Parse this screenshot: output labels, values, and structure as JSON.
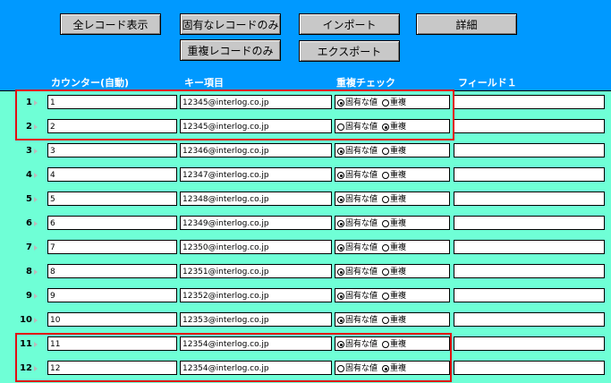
{
  "toolbar": {
    "all_records": "全レコード表示",
    "unique_records": "固有なレコードのみ",
    "duplicate_records": "重複レコードのみ",
    "import": "インポート",
    "export": "エクスポート",
    "details": "詳細"
  },
  "columns": {
    "counter": "カウンター(自動)",
    "key": "キー項目",
    "dup_check": "重複チェック",
    "field1": "フィールド１"
  },
  "radio_labels": {
    "unique": "固有な値",
    "duplicate": "重複"
  },
  "records": [
    {
      "num": "1",
      "counter": "1",
      "key": "12345@interlog.co.jp",
      "status": "unique",
      "field1": ""
    },
    {
      "num": "2",
      "counter": "2",
      "key": "12345@interlog.co.jp",
      "status": "duplicate",
      "field1": ""
    },
    {
      "num": "3",
      "counter": "3",
      "key": "12346@interlog.co.jp",
      "status": "unique",
      "field1": ""
    },
    {
      "num": "4",
      "counter": "4",
      "key": "12347@interlog.co.jp",
      "status": "unique",
      "field1": ""
    },
    {
      "num": "5",
      "counter": "5",
      "key": "12348@interlog.co.jp",
      "status": "unique",
      "field1": ""
    },
    {
      "num": "6",
      "counter": "6",
      "key": "12349@interlog.co.jp",
      "status": "unique",
      "field1": ""
    },
    {
      "num": "7",
      "counter": "7",
      "key": "12350@interlog.co.jp",
      "status": "unique",
      "field1": ""
    },
    {
      "num": "8",
      "counter": "8",
      "key": "12351@interlog.co.jp",
      "status": "unique",
      "field1": ""
    },
    {
      "num": "9",
      "counter": "9",
      "key": "12352@interlog.co.jp",
      "status": "unique",
      "field1": ""
    },
    {
      "num": "10",
      "counter": "10",
      "key": "12353@interlog.co.jp",
      "status": "unique",
      "field1": ""
    },
    {
      "num": "11",
      "counter": "11",
      "key": "12354@interlog.co.jp",
      "status": "unique",
      "field1": ""
    },
    {
      "num": "12",
      "counter": "12",
      "key": "12354@interlog.co.jp",
      "status": "duplicate",
      "field1": ""
    }
  ],
  "colors": {
    "header_bg": "#0099ff",
    "body_bg": "#6fffd6",
    "highlight": "#e01010"
  }
}
